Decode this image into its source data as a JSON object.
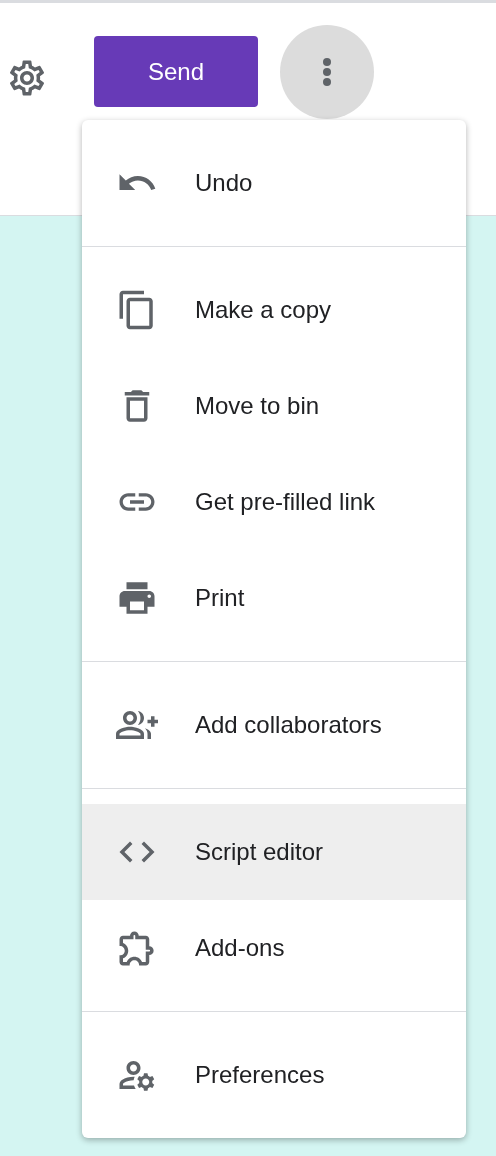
{
  "header": {
    "send_button": "Send"
  },
  "menu": {
    "sections": [
      {
        "items": [
          {
            "label": "Undo",
            "selected": false
          }
        ]
      },
      {
        "items": [
          {
            "label": "Make a copy",
            "selected": false
          },
          {
            "label": "Move to bin",
            "selected": false
          },
          {
            "label": "Get pre-filled link",
            "selected": false
          },
          {
            "label": "Print",
            "selected": false
          }
        ]
      },
      {
        "items": [
          {
            "label": "Add collaborators",
            "selected": false
          }
        ]
      },
      {
        "items": [
          {
            "label": "Script editor",
            "selected": true
          },
          {
            "label": "Add-ons",
            "selected": false
          }
        ]
      },
      {
        "items": [
          {
            "label": "Preferences",
            "selected": false
          }
        ]
      }
    ]
  }
}
